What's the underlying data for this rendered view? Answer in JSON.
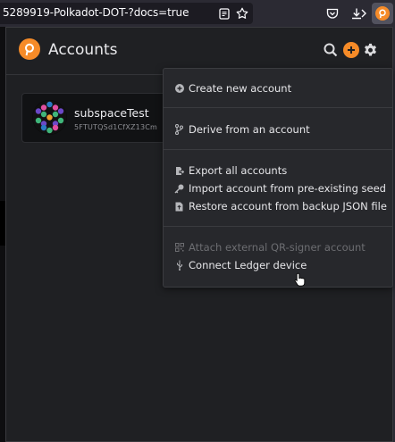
{
  "browser": {
    "url": "5289919-Polkadot-DOT-?docs=true",
    "icons": [
      "reader-mode-icon",
      "bookmark-star-icon",
      "pocket-icon",
      "download-icon",
      "overflow-icon",
      "polkadot-extension-icon"
    ]
  },
  "header": {
    "title": "Accounts",
    "icons": [
      "search-icon",
      "add-icon",
      "gear-icon"
    ]
  },
  "account": {
    "name": "subspaceTest",
    "address": "5FTUTQSd1CfXZ13Cm"
  },
  "menu": {
    "create": "Create new account",
    "derive": "Derive from an account",
    "export": "Export all accounts",
    "import_seed": "Import account from pre-existing seed",
    "restore": "Restore account from backup JSON file",
    "attach_qr": "Attach external QR-signer account",
    "ledger": "Connect Ledger device"
  },
  "colors": {
    "accent": "#f68b28",
    "background": "#1f2023",
    "menu_bg": "#27282c",
    "text": "#e6e6e9",
    "disabled_text": "#6c6d71"
  }
}
